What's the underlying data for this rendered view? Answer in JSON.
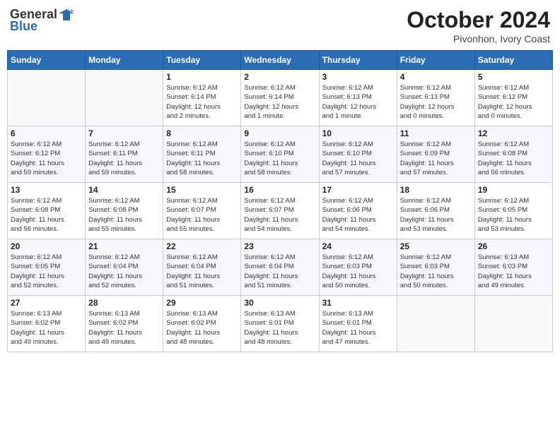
{
  "header": {
    "logo_general": "General",
    "logo_blue": "Blue",
    "month": "October 2024",
    "location": "Pivonhon, Ivory Coast"
  },
  "weekdays": [
    "Sunday",
    "Monday",
    "Tuesday",
    "Wednesday",
    "Thursday",
    "Friday",
    "Saturday"
  ],
  "weeks": [
    [
      {
        "day": "",
        "info": ""
      },
      {
        "day": "",
        "info": ""
      },
      {
        "day": "1",
        "info": "Sunrise: 6:12 AM\nSunset: 6:14 PM\nDaylight: 12 hours\nand 2 minutes."
      },
      {
        "day": "2",
        "info": "Sunrise: 6:12 AM\nSunset: 6:14 PM\nDaylight: 12 hours\nand 1 minute."
      },
      {
        "day": "3",
        "info": "Sunrise: 6:12 AM\nSunset: 6:13 PM\nDaylight: 12 hours\nand 1 minute."
      },
      {
        "day": "4",
        "info": "Sunrise: 6:12 AM\nSunset: 6:13 PM\nDaylight: 12 hours\nand 0 minutes."
      },
      {
        "day": "5",
        "info": "Sunrise: 6:12 AM\nSunset: 6:12 PM\nDaylight: 12 hours\nand 0 minutes."
      }
    ],
    [
      {
        "day": "6",
        "info": "Sunrise: 6:12 AM\nSunset: 6:12 PM\nDaylight: 11 hours\nand 59 minutes."
      },
      {
        "day": "7",
        "info": "Sunrise: 6:12 AM\nSunset: 6:11 PM\nDaylight: 11 hours\nand 59 minutes."
      },
      {
        "day": "8",
        "info": "Sunrise: 6:12 AM\nSunset: 6:11 PM\nDaylight: 11 hours\nand 58 minutes."
      },
      {
        "day": "9",
        "info": "Sunrise: 6:12 AM\nSunset: 6:10 PM\nDaylight: 11 hours\nand 58 minutes."
      },
      {
        "day": "10",
        "info": "Sunrise: 6:12 AM\nSunset: 6:10 PM\nDaylight: 11 hours\nand 57 minutes."
      },
      {
        "day": "11",
        "info": "Sunrise: 6:12 AM\nSunset: 6:09 PM\nDaylight: 11 hours\nand 57 minutes."
      },
      {
        "day": "12",
        "info": "Sunrise: 6:12 AM\nSunset: 6:08 PM\nDaylight: 11 hours\nand 56 minutes."
      }
    ],
    [
      {
        "day": "13",
        "info": "Sunrise: 6:12 AM\nSunset: 6:08 PM\nDaylight: 11 hours\nand 56 minutes."
      },
      {
        "day": "14",
        "info": "Sunrise: 6:12 AM\nSunset: 6:08 PM\nDaylight: 11 hours\nand 55 minutes."
      },
      {
        "day": "15",
        "info": "Sunrise: 6:12 AM\nSunset: 6:07 PM\nDaylight: 11 hours\nand 55 minutes."
      },
      {
        "day": "16",
        "info": "Sunrise: 6:12 AM\nSunset: 6:07 PM\nDaylight: 11 hours\nand 54 minutes."
      },
      {
        "day": "17",
        "info": "Sunrise: 6:12 AM\nSunset: 6:06 PM\nDaylight: 11 hours\nand 54 minutes."
      },
      {
        "day": "18",
        "info": "Sunrise: 6:12 AM\nSunset: 6:06 PM\nDaylight: 11 hours\nand 53 minutes."
      },
      {
        "day": "19",
        "info": "Sunrise: 6:12 AM\nSunset: 6:05 PM\nDaylight: 11 hours\nand 53 minutes."
      }
    ],
    [
      {
        "day": "20",
        "info": "Sunrise: 6:12 AM\nSunset: 6:05 PM\nDaylight: 11 hours\nand 52 minutes."
      },
      {
        "day": "21",
        "info": "Sunrise: 6:12 AM\nSunset: 6:04 PM\nDaylight: 11 hours\nand 52 minutes."
      },
      {
        "day": "22",
        "info": "Sunrise: 6:12 AM\nSunset: 6:04 PM\nDaylight: 11 hours\nand 51 minutes."
      },
      {
        "day": "23",
        "info": "Sunrise: 6:12 AM\nSunset: 6:04 PM\nDaylight: 11 hours\nand 51 minutes."
      },
      {
        "day": "24",
        "info": "Sunrise: 6:12 AM\nSunset: 6:03 PM\nDaylight: 11 hours\nand 50 minutes."
      },
      {
        "day": "25",
        "info": "Sunrise: 6:12 AM\nSunset: 6:03 PM\nDaylight: 11 hours\nand 50 minutes."
      },
      {
        "day": "26",
        "info": "Sunrise: 6:13 AM\nSunset: 6:03 PM\nDaylight: 11 hours\nand 49 minutes."
      }
    ],
    [
      {
        "day": "27",
        "info": "Sunrise: 6:13 AM\nSunset: 6:02 PM\nDaylight: 11 hours\nand 49 minutes."
      },
      {
        "day": "28",
        "info": "Sunrise: 6:13 AM\nSunset: 6:02 PM\nDaylight: 11 hours\nand 49 minutes."
      },
      {
        "day": "29",
        "info": "Sunrise: 6:13 AM\nSunset: 6:02 PM\nDaylight: 11 hours\nand 48 minutes."
      },
      {
        "day": "30",
        "info": "Sunrise: 6:13 AM\nSunset: 6:01 PM\nDaylight: 11 hours\nand 48 minutes."
      },
      {
        "day": "31",
        "info": "Sunrise: 6:13 AM\nSunset: 6:01 PM\nDaylight: 11 hours\nand 47 minutes."
      },
      {
        "day": "",
        "info": ""
      },
      {
        "day": "",
        "info": ""
      }
    ]
  ]
}
